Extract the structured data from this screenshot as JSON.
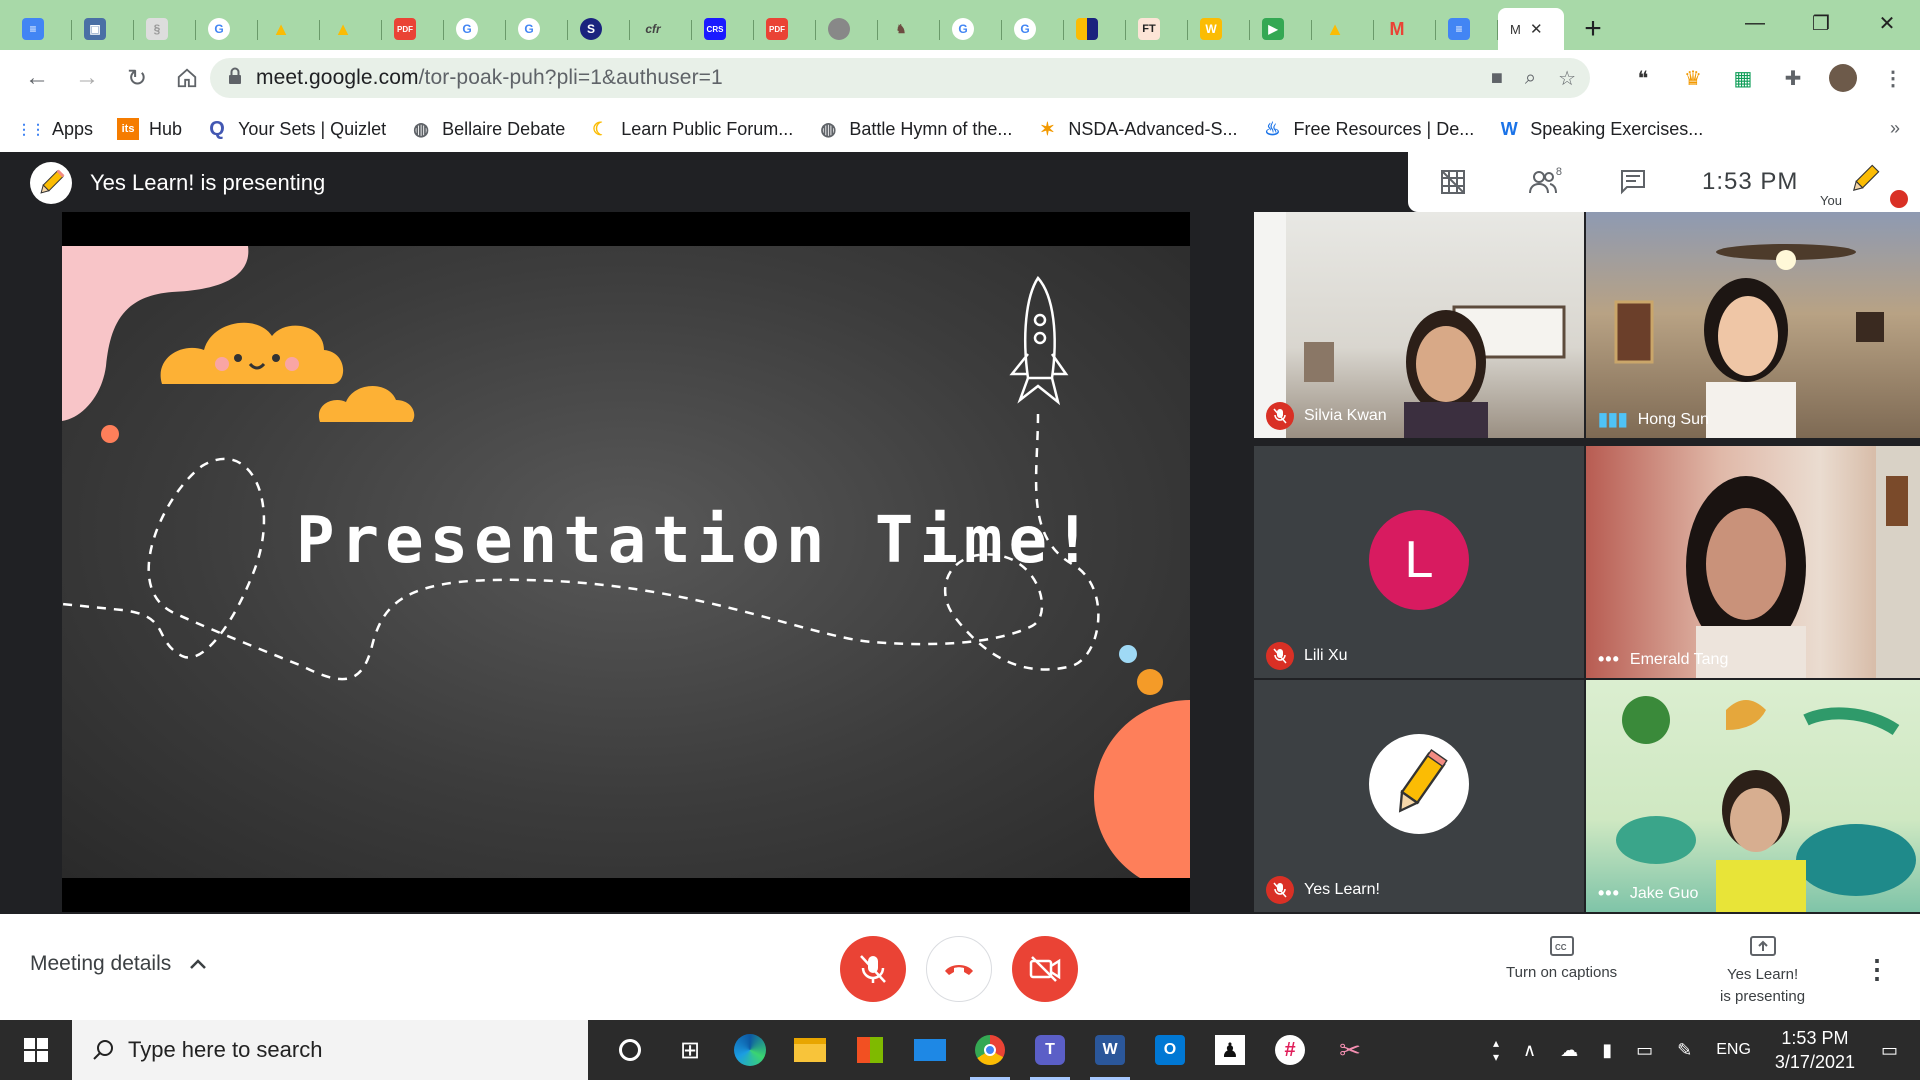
{
  "browser": {
    "active_tab_title": "M",
    "tab_icons": [
      "docs",
      "doc",
      "paper",
      "google",
      "drive",
      "drive",
      "pdf",
      "google",
      "google",
      "circle",
      "text",
      "crs",
      "pdf",
      "circle",
      "pet",
      "google",
      "google",
      "color",
      "ft",
      "w",
      "meet",
      "drive",
      "gmail",
      "docs"
    ],
    "new_tab_label": "+",
    "url_host": "meet.google.com",
    "url_path": "/tor-poak-puh?pli=1&authuser=1"
  },
  "bookmarks": [
    {
      "label": "Apps",
      "icon": "apps-grid-icon"
    },
    {
      "label": "Hub",
      "icon": "its-icon"
    },
    {
      "label": "Your Sets | Quizlet",
      "icon": "quizlet-icon"
    },
    {
      "label": "Bellaire Debate",
      "icon": "globe-icon"
    },
    {
      "label": "Learn Public Forum...",
      "icon": "banana-icon"
    },
    {
      "label": "Battle Hymn of the...",
      "icon": "globe-icon"
    },
    {
      "label": "NSDA-Advanced-S...",
      "icon": "star-person-icon"
    },
    {
      "label": "Free Resources | De...",
      "icon": "podium-icon"
    },
    {
      "label": "Speaking Exercises...",
      "icon": "w-icon"
    }
  ],
  "meet": {
    "presenting_text": "Yes Learn! is presenting",
    "participants_count": "8",
    "time": "1:53 PM",
    "you_label": "You",
    "slide_title": "Presentation Time!",
    "participants": [
      {
        "name": "Silvia Kwan",
        "status": "muted"
      },
      {
        "name": "Hong Sun",
        "status": "speaking"
      },
      {
        "name": "Lili Xu",
        "status": "muted",
        "initial": "L"
      },
      {
        "name": "Emerald Tang",
        "status": "more"
      },
      {
        "name": "Yes Learn!",
        "status": "muted"
      },
      {
        "name": "Jake Guo",
        "status": "more"
      }
    ]
  },
  "controls": {
    "meeting_details": "Meeting details",
    "captions_label": "Turn on captions",
    "presenting_line1": "Yes Learn!",
    "presenting_line2": "is presenting"
  },
  "taskbar": {
    "search_placeholder": "Type here to search",
    "language": "ENG",
    "time": "1:53 PM",
    "date": "3/17/2021"
  },
  "colors": {
    "tabstrip": "#a8d9a8",
    "meet_bg": "#202124",
    "red_button": "#ea4335",
    "avatar_l": "#d81b60",
    "cloud": "#fdb135",
    "pink_blob": "#f8c5c8",
    "coral": "#fe7f5a"
  }
}
